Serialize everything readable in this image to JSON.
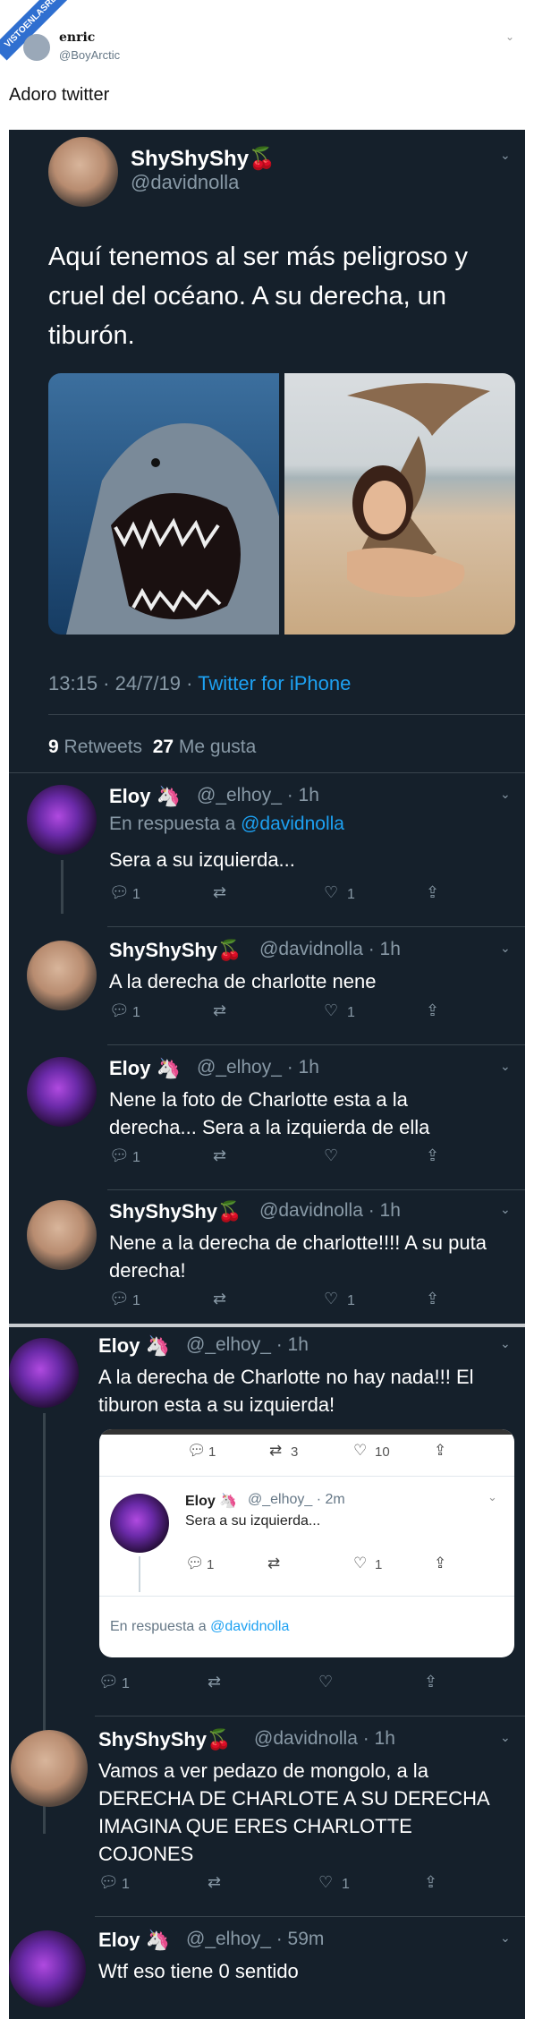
{
  "watermark": "VISTOENLASREDES .COM",
  "outer": {
    "name": "enric",
    "handle": "@BoyArctic",
    "tweet_text": "Adoro twitter",
    "caret": "⌄"
  },
  "main_tweet": {
    "name": "ShyShyShy🍒",
    "handle": "@davidnolla",
    "text": "Aquí tenemos al ser más peligroso y cruel del océano. A su derecha, un tiburón.",
    "time_date": "13:15 · 24/7/19 · ",
    "client": "Twitter for iPhone",
    "retweets": "9",
    "retweets_label": " Retweets",
    "likes": "27",
    "likes_label": " Me gusta"
  },
  "replies": [
    {
      "name": "Eloy 🦄",
      "meta": "@_elhoy_ · 1h",
      "reply_to_label": "En respuesta a ",
      "reply_to_handle": "@davidnolla",
      "text": "Sera a su izquierda...",
      "reply_count": "1",
      "like_count": "1"
    },
    {
      "name": "ShyShyShy🍒",
      "meta": "@davidnolla · 1h",
      "text": "A la derecha de charlotte nene",
      "reply_count": "1",
      "like_count": "1"
    },
    {
      "name": "Eloy 🦄",
      "meta": "@_elhoy_ · 1h",
      "text": "Nene la foto de Charlotte esta a la derecha... Sera a la izquierda de ella",
      "reply_count": "1",
      "like_count": ""
    },
    {
      "name": "ShyShyShy🍒",
      "meta": "@davidnolla · 1h",
      "text": "Nene a la derecha de charlotte!!!! A su puta derecha!",
      "reply_count": "1",
      "like_count": "1"
    },
    {
      "name": "Eloy 🦄",
      "meta": "@_elhoy_ · 1h",
      "text": "A la derecha de Charlotte no hay nada!!! El tiburon esta a su izquierda!",
      "reply_count": "1",
      "like_count": ""
    },
    {
      "name": "ShyShyShy🍒",
      "meta": "@davidnolla · 1h",
      "text": "Vamos a ver pedazo de mongolo, a la DERECHA DE CHARLOTE A SU DERECHA IMAGINA QUE ERES CHARLOTTE COJONES",
      "reply_count": "1",
      "like_count": "1"
    },
    {
      "name": "Eloy 🦄",
      "meta": "@_elhoy_ · 59m",
      "text": "Wtf eso tiene 0 sentido"
    }
  ],
  "embed": {
    "top_counts": {
      "reply": "1",
      "retweet": "3",
      "like": "10"
    },
    "name": "Eloy 🦄",
    "meta": "@_elhoy_ · 2m",
    "text": "Sera a su izquierda...",
    "reply_count": "1",
    "like_count": "1",
    "reply_to_label": "En respuesta a ",
    "reply_to_handle": "@davidnolla"
  },
  "icons": {
    "reply": "💬︎",
    "retweet": "⇄",
    "like": "♡",
    "share": "⇪",
    "caret": "⌄"
  },
  "colors": {
    "background": "#15202b",
    "link": "#1da1f2",
    "muted": "#8899a6"
  }
}
